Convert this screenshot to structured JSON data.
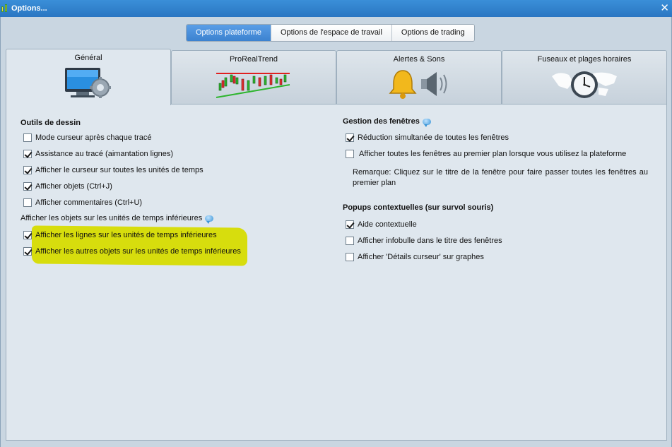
{
  "window": {
    "title": "Options...",
    "close_icon": "close-icon"
  },
  "top_segments": [
    {
      "label": "Options plateforme",
      "active": true
    },
    {
      "label": "Options de l'espace de travail",
      "active": false
    },
    {
      "label": "Options de trading",
      "active": false
    }
  ],
  "tabs": [
    {
      "label": "Général",
      "icon": "monitor-gear-icon",
      "active": true
    },
    {
      "label": "ProRealTrend",
      "icon": "trend-chart-icon",
      "active": false
    },
    {
      "label": "Alertes & Sons",
      "icon": "bell-speaker-icon",
      "active": false
    },
    {
      "label": "Fuseaux et plages horaires",
      "icon": "world-clock-icon",
      "active": false
    }
  ],
  "left": {
    "drawing_title": "Outils de dessin",
    "drawing_options": [
      {
        "label": "Mode curseur après chaque tracé",
        "checked": false
      },
      {
        "label": "Assistance au tracé (aimantation lignes)",
        "checked": true
      },
      {
        "label": "Afficher le curseur sur toutes les unités de temps",
        "checked": true
      },
      {
        "label": "Afficher objets (Ctrl+J)",
        "checked": true
      },
      {
        "label": "Afficher commentaires (Ctrl+U)",
        "checked": false
      }
    ],
    "lower_units_title": "Afficher les objets sur les unités de temps inférieures",
    "lower_units_options": [
      {
        "label": "Afficher les lignes sur les unités de temps inférieures",
        "checked": true
      },
      {
        "label": "Afficher les autres objets sur les unités de temps inférieures",
        "checked": true
      }
    ]
  },
  "right": {
    "windows_title": "Gestion des fenêtres",
    "windows_options": [
      {
        "label": "Réduction simultanée de toutes les fenêtres",
        "checked": true
      },
      {
        "label": "Afficher toutes les fenêtres au premier plan lorsque vous utilisez la plateforme",
        "checked": false
      }
    ],
    "remark": "Remarque: Cliquez sur le titre de la fenêtre pour faire passer toutes les fenêtres au premier plan",
    "popups_title": "Popups contextuelles (sur survol souris)",
    "popups_options": [
      {
        "label": "Aide contextuelle",
        "checked": true
      },
      {
        "label": "Afficher infobulle dans le titre des fenêtres",
        "checked": false
      },
      {
        "label": "Afficher 'Détails curseur' sur graphes",
        "checked": false
      }
    ]
  },
  "colors": {
    "title_bar": "#2a76c2",
    "active_segment": "#3c82d0",
    "highlight": "#d6dc00"
  }
}
